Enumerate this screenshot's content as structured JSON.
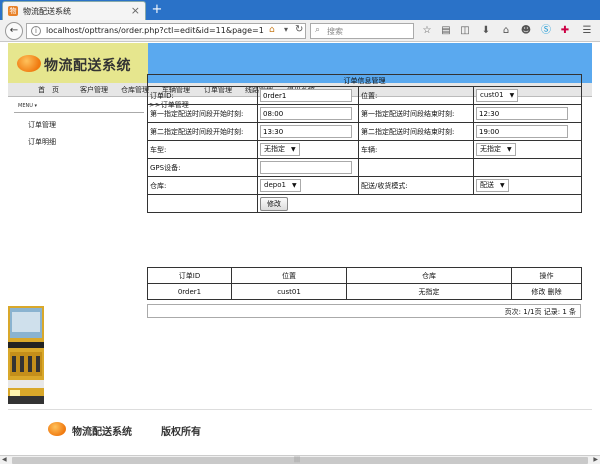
{
  "browser": {
    "tab_title": "物流配送系统",
    "tab_favicon": "物",
    "url": "localhost/opttrans/order.php?ctl=edit&id=11&page=1",
    "search_placeholder": "搜索"
  },
  "header": {
    "logo_text": "物流配送系统"
  },
  "menu": [
    "首　页",
    "客户管理",
    "仓库管理",
    "车辆管理",
    "订单管理",
    "线路管理",
    "退出系统"
  ],
  "sidebar": {
    "header": "MENU ▾",
    "items": [
      "订单管理",
      "订单明细"
    ]
  },
  "breadcrumb": ">>订单管理",
  "form": {
    "title": "订单信息管理",
    "order_id_label": "订单ID:",
    "order_id_value": "0rder1",
    "location_label": "位置:",
    "location_value": "cust01",
    "first_start_label": "第一指定配送时间段开始时刻:",
    "first_start_value": "08:00",
    "first_end_label": "第一指定配送时间段结束时刻:",
    "first_end_value": "12:30",
    "second_start_label": "第二指定配送时间段开始时刻:",
    "second_start_value": "13:30",
    "second_end_label": "第二指定配送时间段结束时刻:",
    "second_end_value": "19:00",
    "car_type_label": "车型:",
    "car_type_value": "无指定",
    "vehicle_label": "车辆:",
    "vehicle_value": "无指定",
    "gps_label": "GPS设备:",
    "gps_value": "",
    "warehouse_label": "仓库:",
    "warehouse_value": "depo1",
    "mode_label": "配送/收货模式:",
    "mode_value": "配送",
    "submit_label": "修改"
  },
  "list": {
    "headers": [
      "订单ID",
      "位置",
      "仓库",
      "操作"
    ],
    "rows": [
      {
        "id": "0rder1",
        "location": "cust01",
        "warehouse": "无指定",
        "edit": "修改",
        "delete": "删除"
      }
    ],
    "pager": "页次: 1/1页 记录: 1 条"
  },
  "footer": {
    "logo_text": "物流配送系统",
    "copyright": "版权所有"
  }
}
